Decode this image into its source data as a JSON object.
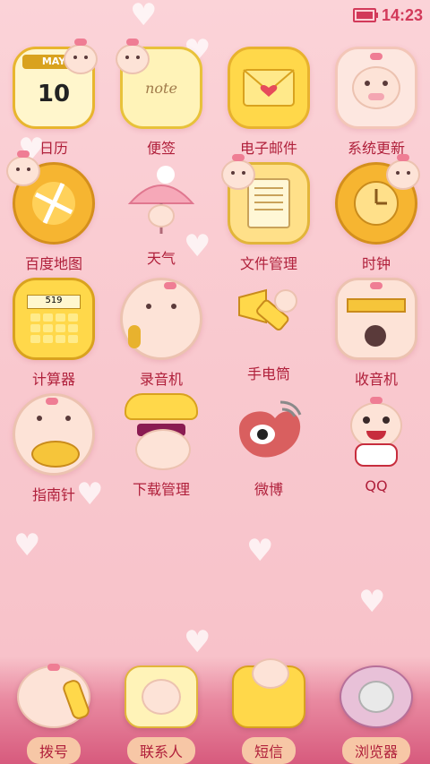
{
  "status_bar": {
    "time": "14:23"
  },
  "apps": [
    {
      "label": "日历",
      "icon": "calendar-icon",
      "icon_month": "MAY",
      "icon_day": "10",
      "color": "#f7c944"
    },
    {
      "label": "便签",
      "icon": "notepad-icon",
      "icon_text": "note",
      "color": "#fbe07a"
    },
    {
      "label": "电子邮件",
      "icon": "email-envelope-icon",
      "color": "#ffd84a"
    },
    {
      "label": "系统更新",
      "icon": "system-update-icon",
      "color": "#fde7e0"
    },
    {
      "label": "百度地图",
      "icon": "map-icon",
      "color": "#f6b531"
    },
    {
      "label": "天气",
      "icon": "weather-umbrella-icon",
      "color": "#f6a8b8"
    },
    {
      "label": "文件管理",
      "icon": "file-manager-icon",
      "color": "#ffe089"
    },
    {
      "label": "时钟",
      "icon": "clock-icon",
      "color": "#f6b531"
    },
    {
      "label": "计算器",
      "icon": "calculator-icon",
      "icon_display": "519",
      "color": "#ffd84a"
    },
    {
      "label": "录音机",
      "icon": "recorder-icon",
      "color": "#fde3d7"
    },
    {
      "label": "手电筒",
      "icon": "flashlight-icon",
      "color": "#ffd84a"
    },
    {
      "label": "收音机",
      "icon": "radio-icon",
      "color": "#fde3d7"
    },
    {
      "label": "指南针",
      "icon": "compass-icon",
      "color": "#f6c53a"
    },
    {
      "label": "下载管理",
      "icon": "download-manager-icon",
      "color": "#ffe07a"
    },
    {
      "label": "微博",
      "icon": "weibo-icon",
      "color": "#e26d6d"
    },
    {
      "label": "QQ",
      "icon": "qq-icon",
      "color": "#fde3d7"
    }
  ],
  "dock": [
    {
      "label": "拨号",
      "icon": "phone-icon",
      "color": "#ffd84a"
    },
    {
      "label": "联系人",
      "icon": "contacts-icon",
      "color": "#fbe07a"
    },
    {
      "label": "短信",
      "icon": "sms-icon",
      "color": "#ffd84a"
    },
    {
      "label": "浏览器",
      "icon": "browser-icon",
      "color": "#e8c1d8"
    }
  ]
}
